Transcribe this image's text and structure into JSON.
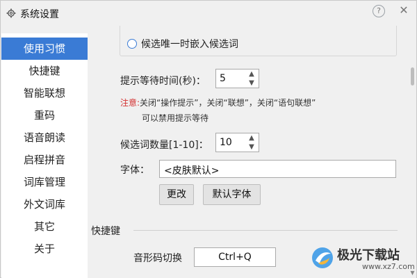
{
  "window": {
    "title": "系统设置",
    "help_glyph": "?",
    "close_glyph": "✕"
  },
  "sidebar": {
    "items": [
      {
        "label": "使用习惯",
        "active": true
      },
      {
        "label": "快捷键"
      },
      {
        "label": "智能联想"
      },
      {
        "label": "重码"
      },
      {
        "label": "语音朗读"
      },
      {
        "label": "启程拼音"
      },
      {
        "label": "词库管理"
      },
      {
        "label": "外文词库"
      },
      {
        "label": "其它"
      },
      {
        "label": "关于"
      }
    ]
  },
  "content": {
    "radio_option": "候选唯一时嵌入候选词",
    "wait_time": {
      "label": "提示等待时间(秒)：",
      "value": "5"
    },
    "note": {
      "prefix": "注意:",
      "line1": "关闭“操作提示”，关闭“联想”，关闭“语句联想”",
      "line2": "可以禁用提示等待"
    },
    "candidate_count": {
      "label": "候选词数量[1-10]：",
      "value": "10"
    },
    "font": {
      "label": "字体：",
      "value": "<皮肤默认>"
    },
    "buttons": {
      "change": "更改",
      "default_font": "默认字体"
    },
    "shortcuts_section": {
      "title": "快捷键",
      "label": "音形码切换",
      "value": "Ctrl+Q"
    }
  },
  "watermark": {
    "text": "极光下载站",
    "url": "www.xz7.com"
  },
  "colors": {
    "accent": "#3a7bd5",
    "note_red": "#d32f2f"
  },
  "icons": {
    "spin_up": "▲",
    "spin_down": "▼",
    "scroll_down": "▼"
  }
}
